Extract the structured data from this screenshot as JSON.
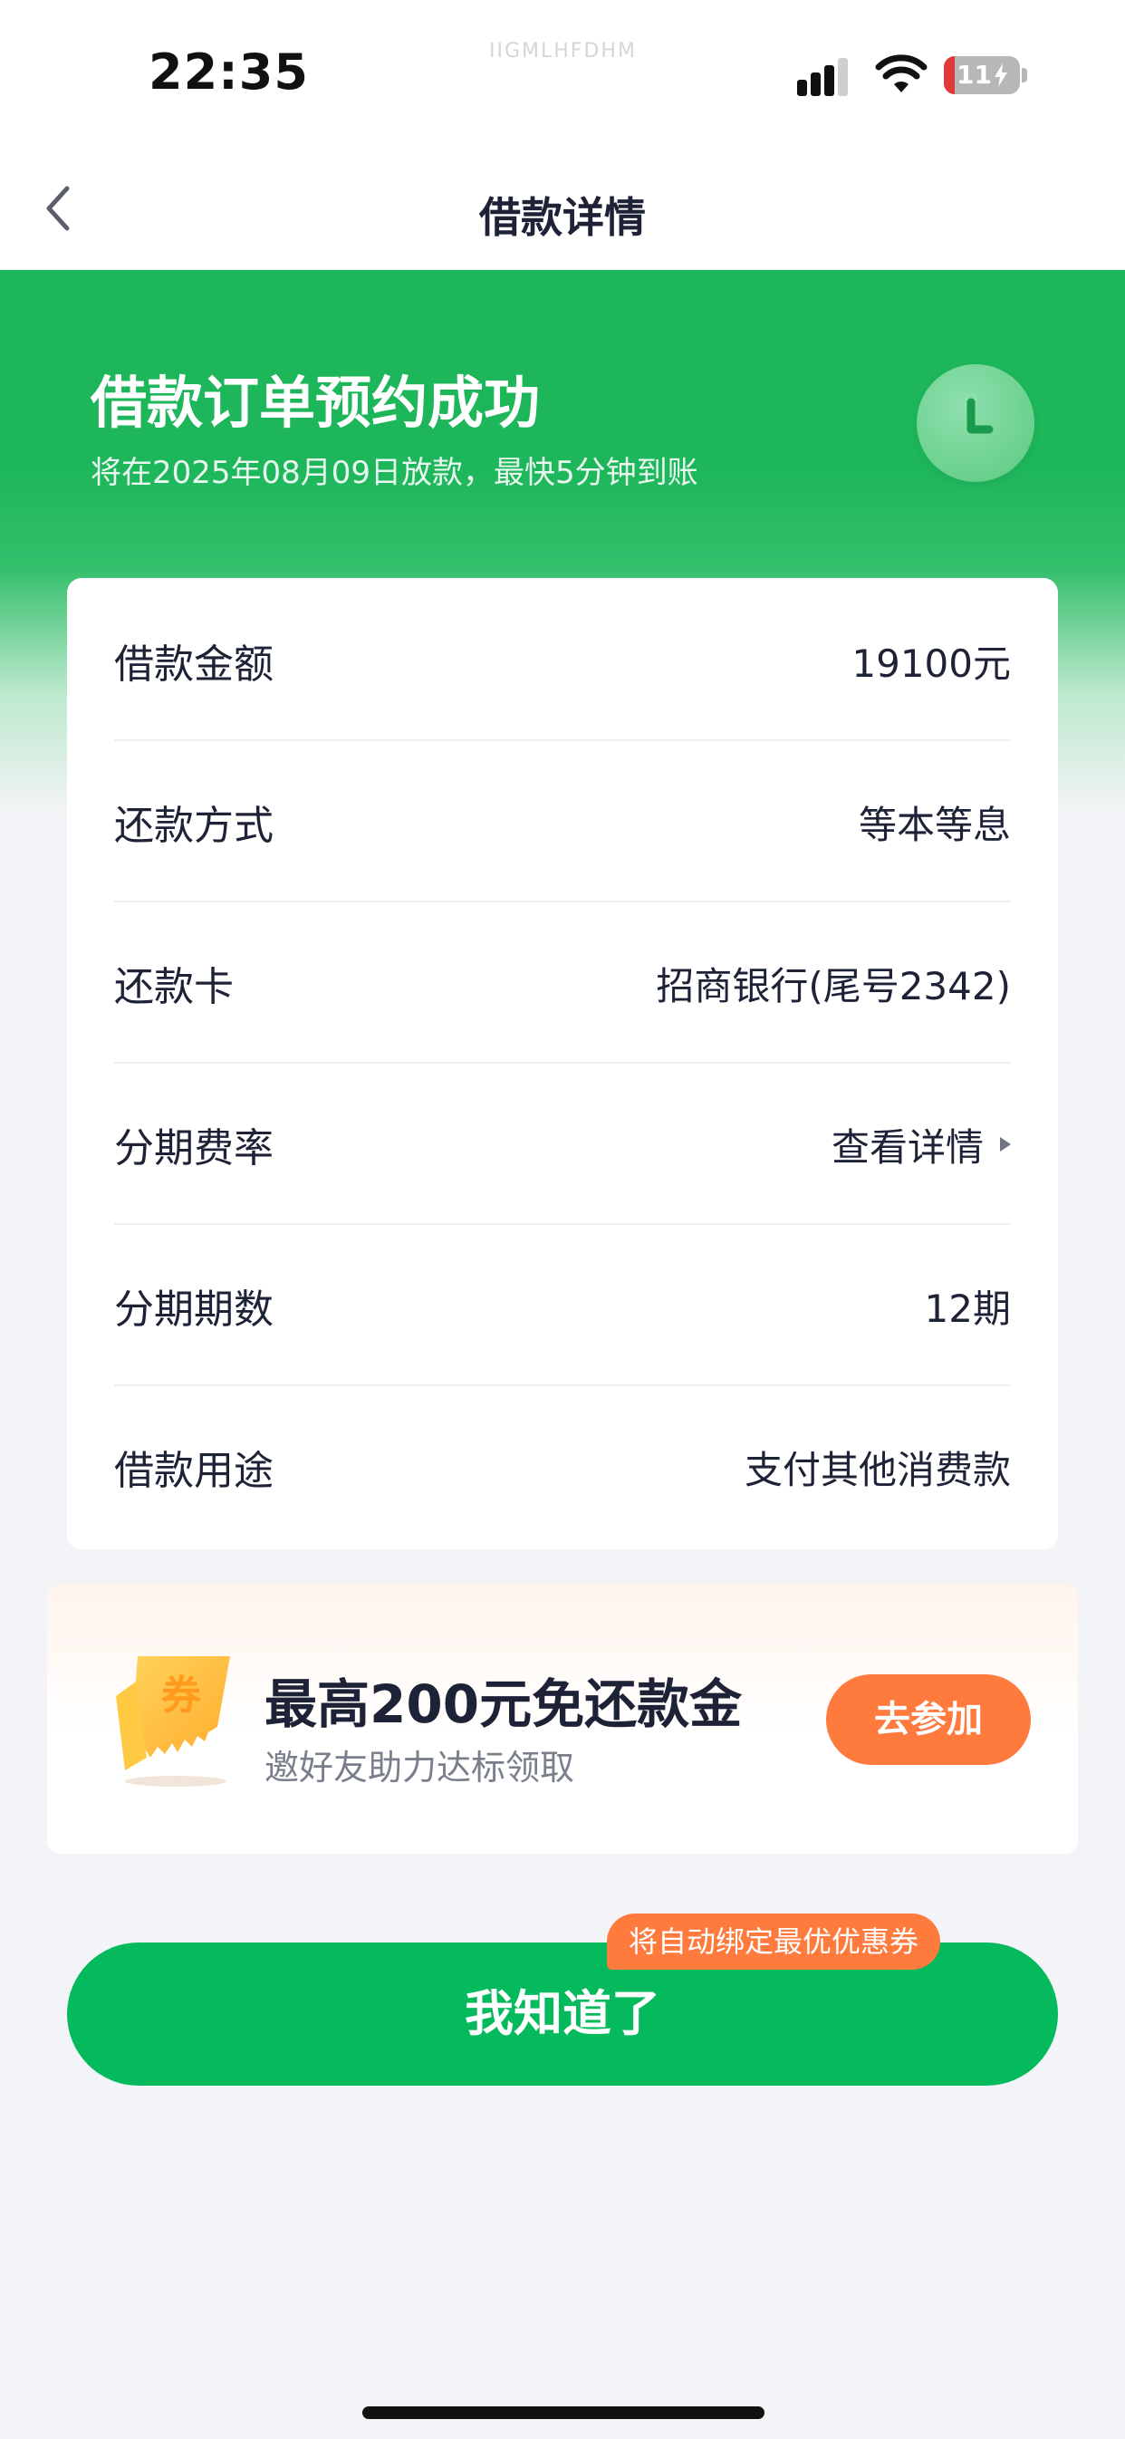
{
  "status_bar": {
    "time": "22:35",
    "watermark": "IIGMLHFDHM",
    "battery_text": "11",
    "icons": [
      "cellular-signal-icon",
      "wifi-icon",
      "battery-icon"
    ]
  },
  "nav": {
    "title": "借款详情",
    "back_icon": "chevron-left-icon"
  },
  "hero": {
    "title": "借款订单预约成功",
    "subtitle": "将在2025年08月09日放款，最快5分钟到账",
    "icon": "clock-icon"
  },
  "details": [
    {
      "label": "借款金额",
      "value": "19100元"
    },
    {
      "label": "还款方式",
      "value": "等本等息"
    },
    {
      "label": "还款卡",
      "value": "招商银行(尾号2342)"
    },
    {
      "label": "分期费率",
      "value": "查看详情"
    },
    {
      "label": "分期期数",
      "value": "12期"
    },
    {
      "label": "借款用途",
      "value": "支付其他消费款"
    }
  ],
  "promo": {
    "title": "最高200元免还款金",
    "subtitle": "邀好友助力达标领取",
    "button": "去参加",
    "coupon_glyph": "券"
  },
  "primary": {
    "button": "我知道了",
    "tag": "将自动绑定最优优惠券"
  },
  "colors": {
    "brand_green": "#05b95d",
    "accent_orange": "#ff7a3d",
    "text_dark": "#1e2237"
  }
}
